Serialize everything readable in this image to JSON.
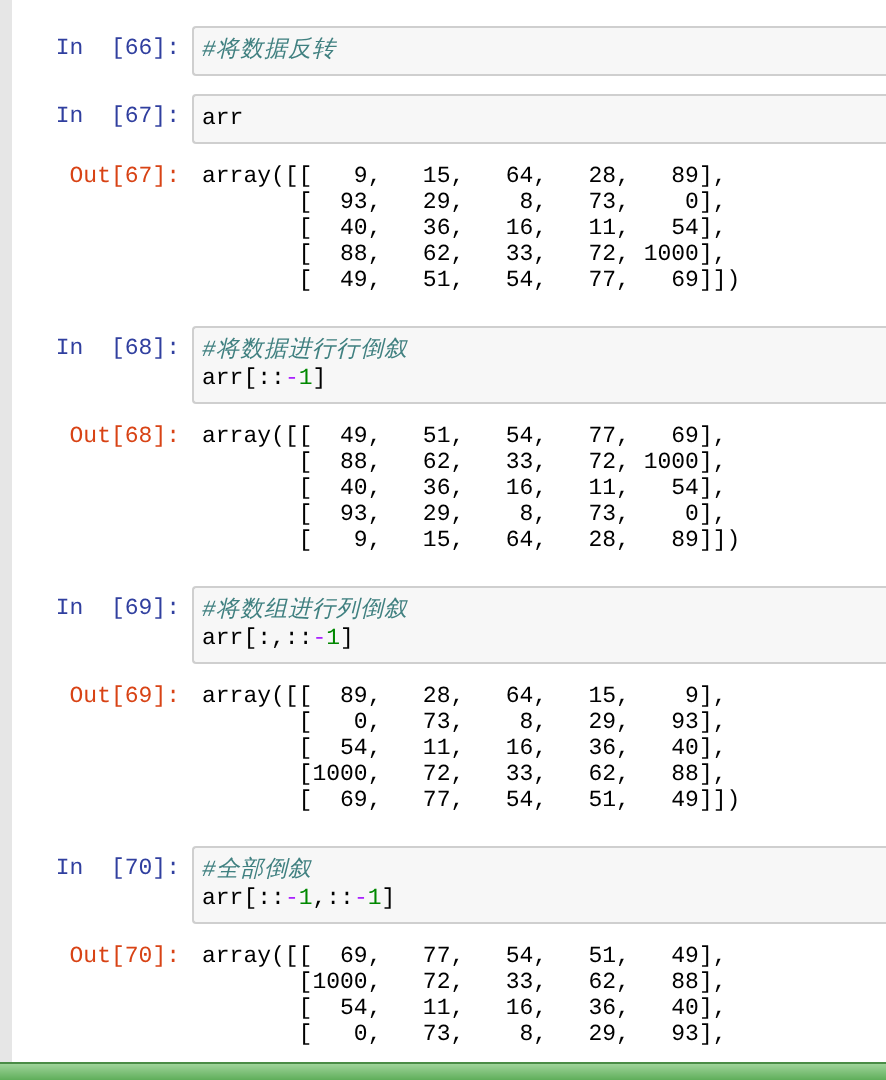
{
  "cells": [
    {
      "kind": "input",
      "prompt": "In  [66]:",
      "lines": [
        [
          {
            "text": "#将数据反转",
            "kind": "comment"
          }
        ]
      ]
    },
    {
      "kind": "input",
      "prompt": "In  [67]:",
      "lines": [
        [
          {
            "text": "arr",
            "kind": "name"
          }
        ]
      ]
    },
    {
      "kind": "output",
      "prompt": "Out[67]:",
      "lines": [
        "array([[   9,   15,   64,   28,   89],",
        "       [  93,   29,    8,   73,    0],",
        "       [  40,   36,   16,   11,   54],",
        "       [  88,   62,   33,   72, 1000],",
        "       [  49,   51,   54,   77,   69]])"
      ]
    },
    {
      "kind": "input",
      "prompt": "In  [68]:",
      "lines": [
        [
          {
            "text": "#将数据进行行倒叙",
            "kind": "comment"
          }
        ],
        [
          {
            "text": "arr",
            "kind": "name"
          },
          {
            "text": "[::",
            "kind": "punct"
          },
          {
            "text": "-",
            "kind": "operator"
          },
          {
            "text": "1",
            "kind": "number"
          },
          {
            "text": "]",
            "kind": "punct"
          }
        ]
      ]
    },
    {
      "kind": "output",
      "prompt": "Out[68]:",
      "lines": [
        "array([[  49,   51,   54,   77,   69],",
        "       [  88,   62,   33,   72, 1000],",
        "       [  40,   36,   16,   11,   54],",
        "       [  93,   29,    8,   73,    0],",
        "       [   9,   15,   64,   28,   89]])"
      ]
    },
    {
      "kind": "input",
      "prompt": "In  [69]:",
      "lines": [
        [
          {
            "text": "#将数组进行列倒叙",
            "kind": "comment"
          }
        ],
        [
          {
            "text": "arr",
            "kind": "name"
          },
          {
            "text": "[:,::",
            "kind": "punct"
          },
          {
            "text": "-",
            "kind": "operator"
          },
          {
            "text": "1",
            "kind": "number"
          },
          {
            "text": "]",
            "kind": "punct"
          }
        ]
      ]
    },
    {
      "kind": "output",
      "prompt": "Out[69]:",
      "lines": [
        "array([[  89,   28,   64,   15,    9],",
        "       [   0,   73,    8,   29,   93],",
        "       [  54,   11,   16,   36,   40],",
        "       [1000,   72,   33,   62,   88],",
        "       [  69,   77,   54,   51,   49]])"
      ]
    },
    {
      "kind": "input",
      "prompt": "In  [70]:",
      "lines": [
        [
          {
            "text": "#全部倒叙",
            "kind": "comment"
          }
        ],
        [
          {
            "text": "arr",
            "kind": "name"
          },
          {
            "text": "[::",
            "kind": "punct"
          },
          {
            "text": "-",
            "kind": "operator"
          },
          {
            "text": "1",
            "kind": "number"
          },
          {
            "text": ",::",
            "kind": "punct"
          },
          {
            "text": "-",
            "kind": "operator"
          },
          {
            "text": "1",
            "kind": "number"
          },
          {
            "text": "]",
            "kind": "punct"
          }
        ]
      ]
    },
    {
      "kind": "output",
      "prompt": "Out[70]:",
      "lines": [
        "array([[  69,   77,   54,   51,   49],",
        "       [1000,   72,   33,   62,   88],",
        "       [  54,   11,   16,   36,   40],",
        "       [   0,   73,    8,   29,   93],"
      ]
    }
  ]
}
